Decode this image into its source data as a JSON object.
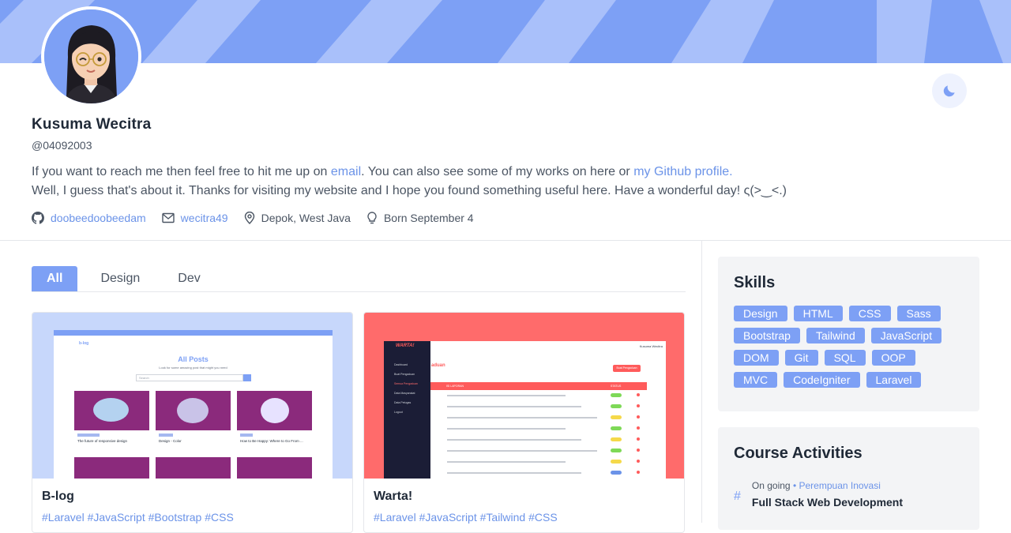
{
  "profile": {
    "name": "Kusuma Wecitra",
    "handle": "@04092003",
    "bio_line1_a": "If you want to reach me then feel free to hit me up on ",
    "bio_email_link": "email",
    "bio_line1_b": ". You can also see some of my works on here or ",
    "bio_github_link": "my Github profile.",
    "bio_line2": "Well, I guess that's about it. Thanks for visiting my website and I hope you found something useful here. Have a wonderful day! ς(>‿<.)",
    "github": "doobeedoobeedam",
    "email": "wecitra49",
    "location": "Depok, West Java",
    "birthday": "Born September 4"
  },
  "colors": {
    "accent": "#7da0f5",
    "link": "#6b93e8",
    "warta_red": "#ff6b6b",
    "blog_blue": "#c7d7fb"
  },
  "icons": [
    "moon-icon",
    "github-icon",
    "mail-icon",
    "map-pin-icon",
    "lightbulb-icon",
    "hash-icon"
  ],
  "tabs": [
    {
      "label": "All",
      "active": true
    },
    {
      "label": "Design",
      "active": false
    },
    {
      "label": "Dev",
      "active": false
    }
  ],
  "projects": [
    {
      "title": "B-log",
      "tags": "#Laravel #JavaScript #Bootstrap #CSS"
    },
    {
      "title": "Warta!",
      "tags": "#Laravel #JavaScript #Tailwind #CSS"
    }
  ],
  "skills": {
    "heading": "Skills",
    "items": [
      "Design",
      "HTML",
      "CSS",
      "Sass",
      "Bootstrap",
      "Tailwind",
      "JavaScript",
      "DOM",
      "Git",
      "SQL",
      "OOP",
      "MVC",
      "CodeIgniter",
      "Laravel"
    ]
  },
  "courses": {
    "heading": "Course Activities",
    "items": [
      {
        "status": "On going",
        "org": "Perempuan Inovasi",
        "name": "Full Stack Web Development"
      }
    ]
  },
  "mock_blog": {
    "brand": "b-log",
    "heading": "All Posts",
    "subheading": "Look for some amazing post that might you need",
    "search_placeholder": "Search",
    "posts": [
      "The future of responsive design",
      "Design - Color",
      "How to Be Happy: Where to Go From ..."
    ]
  },
  "mock_warta": {
    "brand": "WARTA!",
    "user": "Kusuma Wecitra",
    "menu": [
      "Dashboard",
      "Buat Pengaduan",
      "Semua Pengaduan",
      "Data Masyarakat",
      "Data Petugas",
      "Logout"
    ],
    "button": "Buat Pengaduan",
    "section": "aduan",
    "col_report": "ISI LAPORAN",
    "col_status": "STATUS"
  }
}
